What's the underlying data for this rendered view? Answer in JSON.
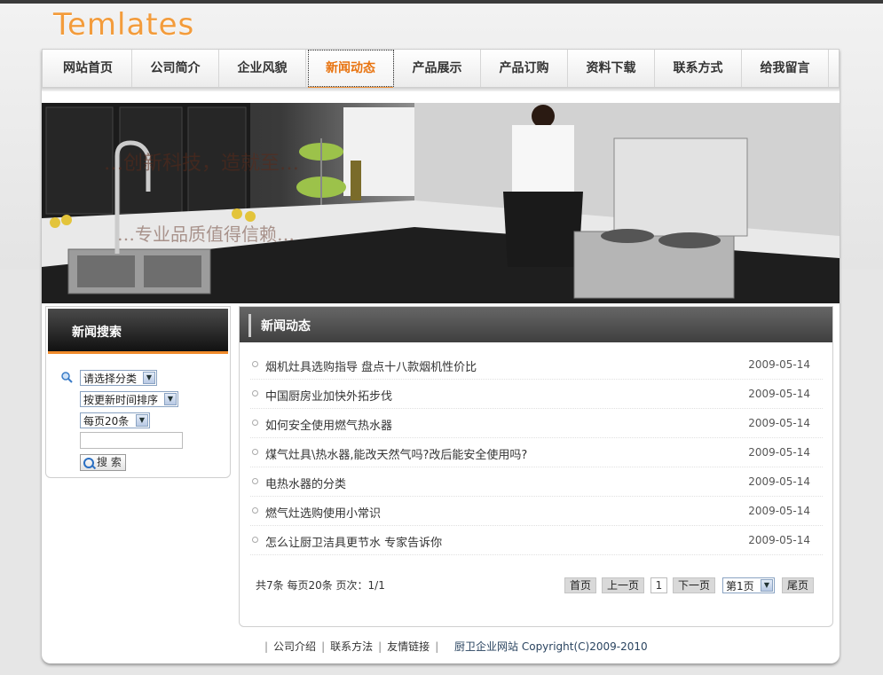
{
  "logo": "Temlates",
  "nav": [
    {
      "label": "网站首页",
      "name": "nav-home"
    },
    {
      "label": "公司简介",
      "name": "nav-about"
    },
    {
      "label": "企业风貌",
      "name": "nav-style"
    },
    {
      "label": "新闻动态",
      "name": "nav-news",
      "active": true
    },
    {
      "label": "产品展示",
      "name": "nav-products"
    },
    {
      "label": "产品订购",
      "name": "nav-order"
    },
    {
      "label": "资料下载",
      "name": "nav-download"
    },
    {
      "label": "联系方式",
      "name": "nav-contact"
    },
    {
      "label": "给我留言",
      "name": "nav-message"
    }
  ],
  "sidebar": {
    "title": "新闻搜索",
    "category_select": "请选择分类",
    "sort_select": "按更新时间排序",
    "pagesize_select": "每页20条",
    "keyword_value": "",
    "search_button": "搜 索"
  },
  "main": {
    "title": "新闻动态",
    "news": [
      {
        "title": "烟机灶具选购指导  盘点十八款烟机性价比",
        "date": "2009-05-14"
      },
      {
        "title": "中国厨房业加快外拓步伐",
        "date": "2009-05-14"
      },
      {
        "title": "如何安全使用燃气热水器",
        "date": "2009-05-14"
      },
      {
        "title": "煤气灶具\\热水器,能改天然气吗?改后能安全使用吗?",
        "date": "2009-05-14"
      },
      {
        "title": "电热水器的分类",
        "date": "2009-05-14"
      },
      {
        "title": "燃气灶选购使用小常识",
        "date": "2009-05-14"
      },
      {
        "title": "怎么让厨卫洁具更节水  专家告诉你",
        "date": "2009-05-14"
      }
    ],
    "pager_info": "共7条  每页20条  页次：1/1",
    "pager": {
      "first": "首页",
      "prev": "上一页",
      "current": "1",
      "next": "下一页",
      "page_select": "第1页",
      "last": "尾页"
    }
  },
  "footer": {
    "links": [
      "公司介绍",
      "联系方法",
      "友情链接"
    ],
    "site_name": "厨卫企业网站",
    "copyright": "Copyright(C)2009-2010"
  },
  "banner": {
    "overlay_text_1": "…创新科技，造就至…",
    "overlay_text_2": "…专业品质值得信赖…"
  }
}
